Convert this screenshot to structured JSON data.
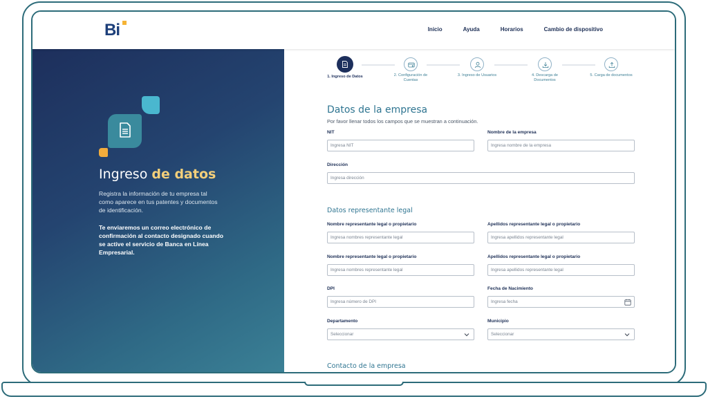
{
  "header": {
    "logo_text": "Bi",
    "nav": [
      "Inicio",
      "Ayuda",
      "Horarios",
      "Cambio de dispositivo"
    ]
  },
  "hero": {
    "title_plain": "Ingreso ",
    "title_highlight": "de datos",
    "description": "Registra la información de tu empresa tal como aparece en tus patentes y documentos de identificación.",
    "note": "Te enviaremos un correo electrónico de confirmación al contacto designado cuando se active el servicio de Banca en Línea Empresarial."
  },
  "stepper": {
    "steps": [
      {
        "label": "1. Ingreso de Datos",
        "icon": "document-icon",
        "active": true
      },
      {
        "label": "2. Configuración de Cuentas",
        "icon": "card-settings-icon",
        "active": false
      },
      {
        "label": "3. Ingreso de Usuarios",
        "icon": "user-icon",
        "active": false
      },
      {
        "label": "4. Descarga de Documentos",
        "icon": "download-icon",
        "active": false
      },
      {
        "label": "5. Carga de documentos",
        "icon": "upload-icon",
        "active": false
      }
    ]
  },
  "form": {
    "company_title": "Datos de la empresa",
    "intro": "Por favor llenar todos los campos que se muestran a continuación.",
    "nit": {
      "label": "NIT",
      "placeholder": "Ingresa NIT"
    },
    "company_name": {
      "label": "Nombre de la empresa",
      "placeholder": "Ingresa nombre de la empresa"
    },
    "address": {
      "label": "Dirección",
      "placeholder": "Ingresa dirección"
    },
    "legal_title": "Datos representante legal",
    "rep_names_1": {
      "label": "Nombre representante legal o propietario",
      "placeholder": "Ingresa nombres representante legal"
    },
    "rep_surnames_1": {
      "label": "Apellidos representante legal o propietario",
      "placeholder": "Ingresa apellidos representante legal"
    },
    "rep_names_2": {
      "label": "Nombre representante legal o propietario",
      "placeholder": "Ingresa nombres representante legal"
    },
    "rep_surnames_2": {
      "label": "Apellidos representante legal o propietario",
      "placeholder": "Ingresa apellidos representante legal"
    },
    "dpi": {
      "label": "DPI",
      "placeholder": "Ingresa número de DPI"
    },
    "birth_date": {
      "label": "Fecha de Nacimiento",
      "placeholder": "Ingresa fecha"
    },
    "department": {
      "label": "Departamento",
      "selected": "Seleccionar"
    },
    "municipality": {
      "label": "Municipio",
      "selected": "Seleccionar"
    },
    "contact_title": "Contacto de la empresa"
  },
  "colors": {
    "frame": "#2c6b79",
    "navy": "#1d2f5c",
    "teal": "#2f7591",
    "accent_yellow": "#f3cf7a"
  }
}
